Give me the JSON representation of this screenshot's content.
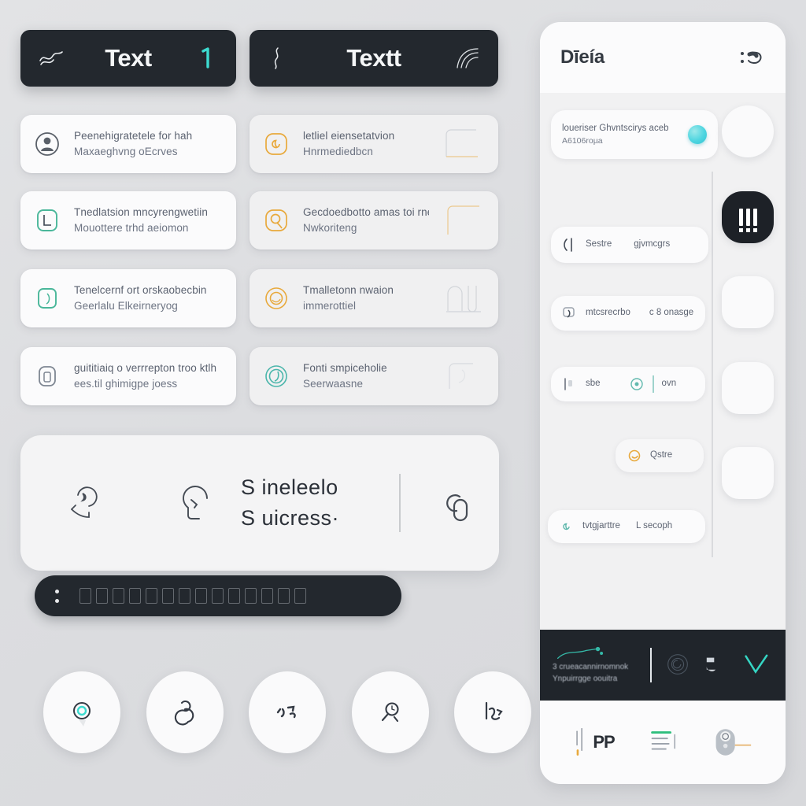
{
  "theme": {
    "background": "#dcdde0",
    "card": "#fbfbfc",
    "dark": "#23282e",
    "accent_teal": "#3ddbd0",
    "accent_amber": "#e8a93c",
    "accent_green": "#4ab79a",
    "text": "#5b6270"
  },
  "headers": [
    {
      "icon": "squiggle-icon",
      "title": "Text",
      "trailing_icon": "cursor-tick-icon"
    },
    {
      "icon": "brace-icon",
      "title": "Textt",
      "trailing_icon": "arcs-icon"
    }
  ],
  "list_left": [
    {
      "icon": "person-circle-icon",
      "line1": "Peenehigratetele for hah",
      "line2": "Maxaeghvng oEcrves"
    },
    {
      "icon": "document-rounded-icon",
      "line1": "Tnedlatsion mncyrengwetiin",
      "line2": "Mouottere trhd aeiomon"
    },
    {
      "icon": "leaf-card-icon",
      "line1": "Tenelcernf ort orskaobecbin",
      "line2": "Geerlalu Elkeirneryog"
    },
    {
      "icon": "battery-card-icon",
      "line1": "guititiaiq o verrrepton troo ktlh",
      "line2": "ees.til ghimigpe joess"
    }
  ],
  "list_right": [
    {
      "icon": "spiral-amber-icon",
      "line1": "letliel eiensetatvion",
      "line2": "Hnrmediedbcn",
      "thumb": "sheet-corner-thumb"
    },
    {
      "icon": "clock-amber-icon",
      "line1": "Gecdoedbotto amas toi rneagbien",
      "line2": "Nwkoriteng",
      "thumb": "bracket-thumb"
    },
    {
      "icon": "ring-amber-icon",
      "line1": "Tmalletonn nwaion",
      "line2": "immerottiel",
      "thumb": "arch-thumb"
    },
    {
      "icon": "leaf-teal-circle-icon",
      "line1": "Fonti smpiceholie",
      "line2": "Seerwaasne",
      "thumb": "tag-thumb"
    }
  ],
  "hero": {
    "left_icon": "hand-leaf-icon",
    "mid_icon": "head-profile-icon",
    "line1": "S ineleelo",
    "line2": "S uicress·",
    "right_icon": "link-loop-icon",
    "bar": {
      "dots_icon": "two-dots-icon",
      "glyph_count": 14
    }
  },
  "round_buttons": [
    {
      "icon": "target-ring-icon"
    },
    {
      "icon": "knot-loop-icon"
    },
    {
      "icon": "scribble-marks-icon"
    },
    {
      "icon": "magnifier-icon"
    },
    {
      "icon": "flow-arrow-icon"
    }
  ],
  "phone": {
    "title": "Dīeía",
    "menu_icon": "dots-arc-icon",
    "rows": [
      {
        "name": "notice-row",
        "line1": "loueriser Ghvntscirys aceb",
        "line2": "A6106roµa",
        "trailing": "teal-dot-toggle"
      },
      {
        "name": "search-row",
        "leading_icon": "bracket-bar-icon",
        "line1": "Sestre",
        "line2": "gjvmcgrs"
      },
      {
        "name": "message-row",
        "leading_icon": "chat-square-icon",
        "line1": "mtcsrecrbo",
        "line2": "c 8 onasge"
      },
      {
        "name": "toggle-row",
        "leading_icon": "slider-bar-icon",
        "line1": "sbe",
        "mid_icon": "dot-circle-teal-icon",
        "line2": "ovn"
      },
      {
        "name": "tag-row",
        "leading_icon": "ring-amber-small-icon",
        "line1": "Qstre"
      },
      {
        "name": "profile-row",
        "leading_icon": "spiral-teal-small-icon",
        "line1": "tvtgjarttre",
        "line2": "L secoph"
      }
    ],
    "side_buttons": [
      {
        "icon": "blank-tile-icon",
        "dark": false
      },
      {
        "icon": "bars-exclaim-icon",
        "dark": true
      },
      {
        "icon": "blank-tile-icon",
        "dark": false
      },
      {
        "icon": "blank-tile-icon",
        "dark": false
      },
      {
        "icon": "blank-tile-icon",
        "dark": false
      }
    ],
    "banner": {
      "spark_icon": "sparkline-icon",
      "line1": "3 crueacannirnomnok",
      "line2": "Ynpuirrgge oouitra",
      "icons": [
        "spiral-ring-icon",
        "cloud-flag-icon",
        "check-v-icon"
      ]
    },
    "nav": [
      {
        "name": "nav-pp",
        "label": "PP",
        "icon": "bars-label-icon"
      },
      {
        "name": "nav-lines",
        "label": "",
        "icon": "list-lines-icon"
      },
      {
        "name": "nav-device",
        "label": "",
        "icon": "device-pill-icon"
      }
    ]
  }
}
